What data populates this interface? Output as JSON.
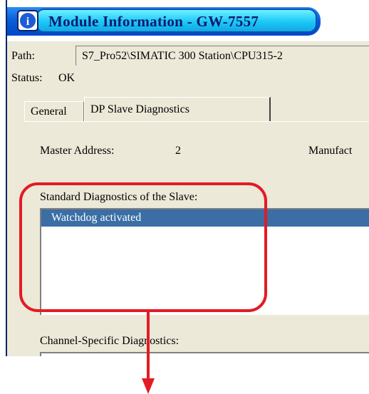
{
  "window": {
    "title": "Module Information - GW-7557",
    "path_label": "Path:",
    "path_value": "S7_Pro52\\SIMATIC 300 Station\\CPU315-2",
    "status_label": "Status:",
    "status_value": "OK"
  },
  "tabs": [
    {
      "label": "General"
    },
    {
      "label": "DP Slave Diagnostics"
    }
  ],
  "diag": {
    "master_label": "Master Address:",
    "master_value": "2",
    "manufacturer_label": "Manufact",
    "std_label": "Standard Diagnostics of the Slave:",
    "std_items": [
      "Watchdog activated"
    ],
    "channel_label": "Channel-Specific Diagnostics:"
  },
  "colors": {
    "highlight": "#e31b23",
    "selection": "#3a6ea5"
  }
}
